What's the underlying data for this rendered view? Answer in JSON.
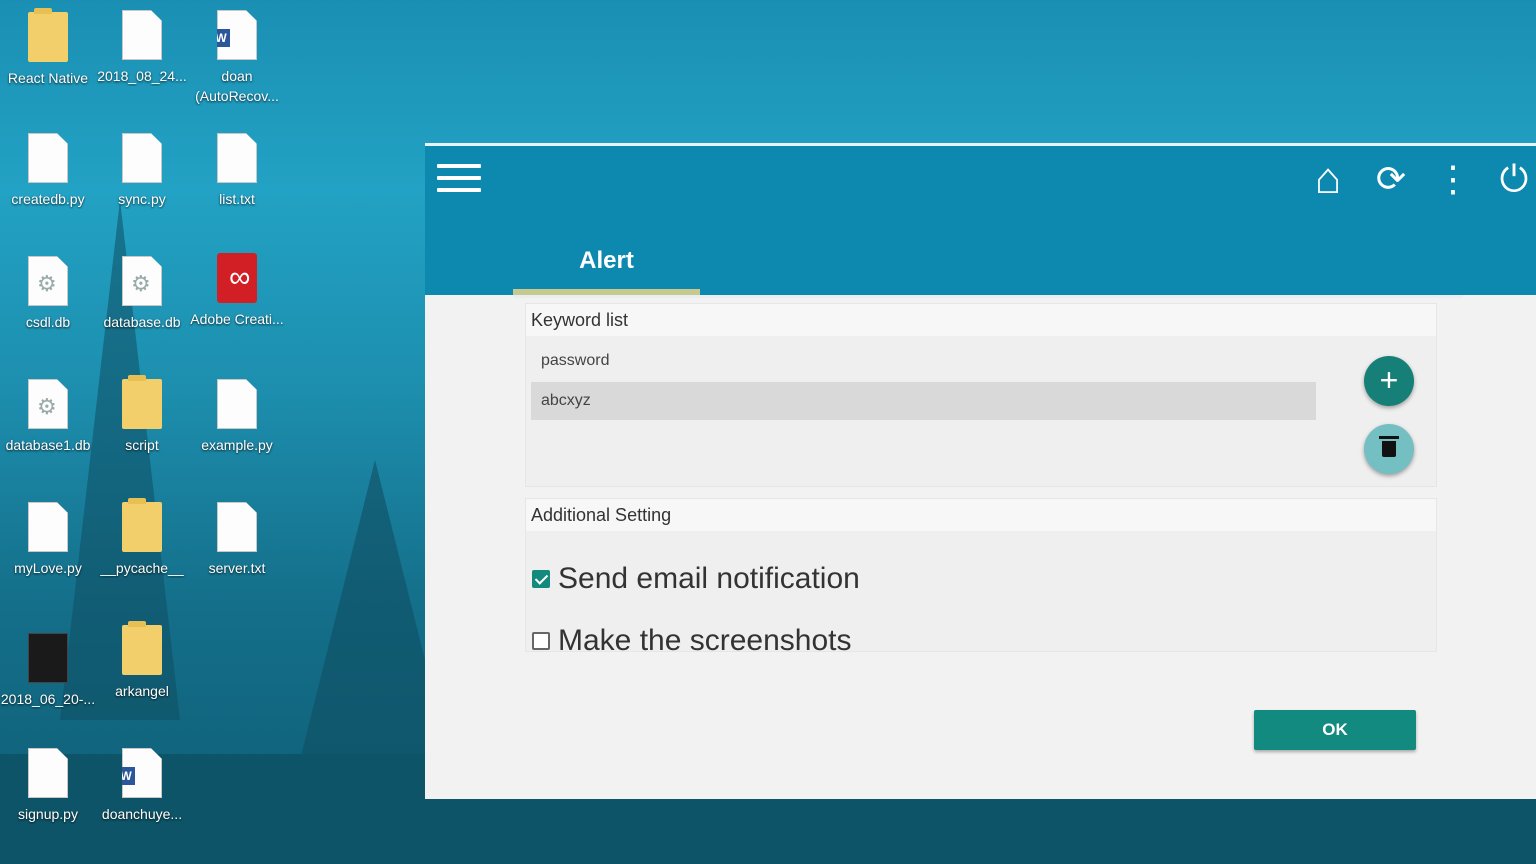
{
  "desktop": {
    "icons": [
      {
        "label": "React Native",
        "type": "folder"
      },
      {
        "label": "2018_08_24...",
        "type": "doc"
      },
      {
        "label": "doan (AutoRecov...",
        "type": "word"
      },
      {
        "label": "createdb.py",
        "type": "doc"
      },
      {
        "label": "sync.py",
        "type": "doc"
      },
      {
        "label": "list.txt",
        "type": "doc"
      },
      {
        "label": "csdl.db",
        "type": "db"
      },
      {
        "label": "database.db",
        "type": "db"
      },
      {
        "label": "Adobe Creati...",
        "type": "adobe"
      },
      {
        "label": "database1.db",
        "type": "db"
      },
      {
        "label": "script",
        "type": "folder"
      },
      {
        "label": "example.py",
        "type": "doc"
      },
      {
        "label": "myLove.py",
        "type": "doc"
      },
      {
        "label": "__pycache__",
        "type": "folder"
      },
      {
        "label": "server.txt",
        "type": "doc"
      },
      {
        "label": "2018_06_20-...",
        "type": "video"
      },
      {
        "label": "arkangel",
        "type": "folder"
      },
      {
        "label": "signup.py",
        "type": "doc"
      },
      {
        "label": "doanchuye...",
        "type": "word"
      }
    ]
  },
  "app": {
    "toolbar": {
      "menu_icon": "hamburger-menu-icon",
      "home_icon": "home-icon",
      "sync_icon": "sync-icon",
      "more_icon": "more-vertical-icon",
      "power_icon": "power-icon",
      "home_glyph": "⌂",
      "sync_glyph": "⟳",
      "more_glyph": "⋮",
      "power_glyph": "⏻"
    },
    "tab": {
      "label": "Alert"
    },
    "keyword_panel": {
      "title": "Keyword list",
      "items": [
        "password",
        "abcxyz"
      ],
      "selected_index": 1,
      "add_glyph": "+"
    },
    "settings_panel": {
      "title": "Additional Setting",
      "options": [
        {
          "label": "Send email notification",
          "checked": true
        },
        {
          "label": "Make the screenshots",
          "checked": false
        }
      ]
    },
    "ok_label": "OK",
    "colors": {
      "appbar": "#0d89b0",
      "accent": "#128a80",
      "fab_add": "#157f78",
      "fab_delete": "#73bfc2",
      "tab_indicator": "#c8c98f"
    }
  }
}
